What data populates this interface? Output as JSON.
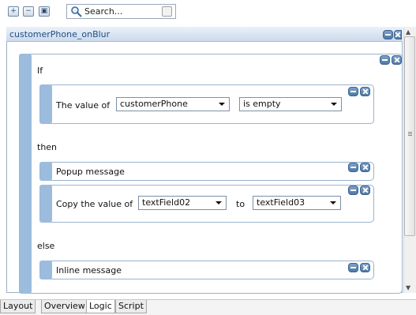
{
  "toolbar": {
    "icons": [
      "expand-all-icon",
      "collapse-all-icon",
      "screenshot-icon"
    ],
    "search": {
      "placeholder": "Search..."
    }
  },
  "panel": {
    "title": "customerPhone_onBlur",
    "if_label": "If",
    "condition": {
      "prefix": "The value of",
      "field": "customerPhone",
      "operator": "is empty"
    },
    "then_label": "then",
    "then_actions": [
      {
        "label": "Popup message"
      },
      {
        "label": "Copy the value of",
        "from": "textField02",
        "to_label": "to",
        "to": "textField03"
      }
    ],
    "else_label": "else",
    "else_actions": [
      {
        "label": "Inline message"
      }
    ]
  },
  "tabs": [
    {
      "label": "Layout",
      "active": false
    },
    {
      "label": "Overview",
      "active": false
    },
    {
      "label": "Logic",
      "active": true
    },
    {
      "label": "Script",
      "active": false
    }
  ],
  "colors": {
    "title_blue": "#1f4d86",
    "block_bar": "#9bbcdc",
    "button_blue": "#4e78a6"
  }
}
